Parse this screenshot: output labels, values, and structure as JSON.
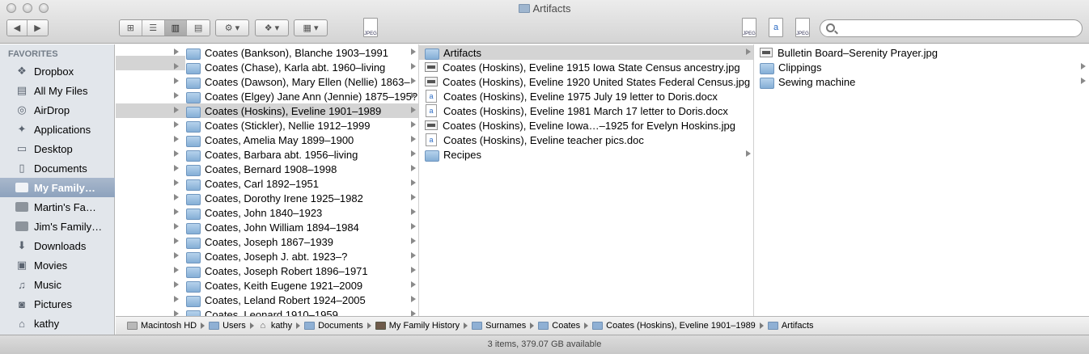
{
  "window": {
    "title": "Artifacts"
  },
  "toolbar": {
    "back_glyph": "◀",
    "forward_glyph": "▶",
    "view_modes": [
      {
        "icon": "icon-view-icon",
        "glyph": "⊞"
      },
      {
        "icon": "list-view-icon",
        "glyph": "☰"
      },
      {
        "icon": "column-view-icon",
        "glyph": "▥"
      },
      {
        "icon": "coverflow-view-icon",
        "glyph": "▤"
      }
    ],
    "action_glyph": "⚙ ▾",
    "dropbox_glyph": "❖ ▾",
    "arrange_glyph": "▦ ▾",
    "jpeg_label": "JPEG",
    "word_glyph": "a"
  },
  "sidebar": {
    "heading": "FAVORITES",
    "items": [
      {
        "label": "Dropbox",
        "icon": "dropbox-icon",
        "glyph": "❖"
      },
      {
        "label": "All My Files",
        "icon": "all-files-icon",
        "glyph": "▤"
      },
      {
        "label": "AirDrop",
        "icon": "airdrop-icon",
        "glyph": "◎"
      },
      {
        "label": "Applications",
        "icon": "applications-icon",
        "glyph": "✦"
      },
      {
        "label": "Desktop",
        "icon": "desktop-icon",
        "glyph": "▭"
      },
      {
        "label": "Documents",
        "icon": "documents-icon",
        "glyph": "▯"
      },
      {
        "label": "My Family…",
        "icon": "folder-icon",
        "glyph": ""
      },
      {
        "label": "Martin's Fa…",
        "icon": "folder-icon",
        "glyph": ""
      },
      {
        "label": "Jim's Family…",
        "icon": "folder-icon",
        "glyph": ""
      },
      {
        "label": "Downloads",
        "icon": "downloads-icon",
        "glyph": "⬇"
      },
      {
        "label": "Movies",
        "icon": "movies-icon",
        "glyph": "▣"
      },
      {
        "label": "Music",
        "icon": "music-icon",
        "glyph": "♫"
      },
      {
        "label": "Pictures",
        "icon": "pictures-icon",
        "glyph": "◙"
      },
      {
        "label": "kathy",
        "icon": "home-icon",
        "glyph": "⌂"
      }
    ],
    "selected_index": 6
  },
  "columns": {
    "surnames": [
      "Coates (Bankson), Blanche 1903–1991",
      "Coates (Chase), Karla abt. 1960–living",
      "Coates (Dawson), Mary Ellen (Nellie) 1863–",
      "Coates (Elgey) Jane Ann (Jennie) 1875–195?",
      "Coates (Hoskins), Eveline 1901–1989",
      "Coates (Stickler), Nellie 1912–1999",
      "Coates, Amelia May 1899–1900",
      "Coates, Barbara abt. 1956–living",
      "Coates, Bernard 1908–1998",
      "Coates, Carl 1892–1951",
      "Coates, Dorothy Irene 1925–1982",
      "Coates, John 1840–1923",
      "Coates, John William 1894–1984",
      "Coates, Joseph 1867–1939",
      "Coates, Joseph J. abt. 1923–?",
      "Coates, Joseph Robert 1896–1971",
      "Coates, Keith Eugene 1921–2009",
      "Coates, Leland Robert 1924–2005",
      "Coates, Leonard 1910–1959"
    ],
    "surnames_selected": 4,
    "eveline": [
      {
        "label": "Artifacts",
        "kind": "folder"
      },
      {
        "label": "Coates (Hoskins), Eveline 1915 Iowa State Census ancestry.jpg",
        "kind": "image"
      },
      {
        "label": "Coates (Hoskins), Eveline 1920 United States Federal Census.jpg",
        "kind": "image"
      },
      {
        "label": "Coates (Hoskins), Eveline 1975 July 19 letter to Doris.docx",
        "kind": "word"
      },
      {
        "label": "Coates (Hoskins), Eveline 1981 March 17 letter to Doris.docx",
        "kind": "word"
      },
      {
        "label": "Coates (Hoskins), Eveline Iowa…–1925 for Evelyn Hoskins.jpg",
        "kind": "image"
      },
      {
        "label": "Coates (Hoskins), Eveline teacher pics.doc",
        "kind": "word"
      },
      {
        "label": "Recipes",
        "kind": "folder"
      }
    ],
    "eveline_selected": 0,
    "artifacts": [
      {
        "label": "Bulletin Board–Serenity Prayer.jpg",
        "kind": "image"
      },
      {
        "label": "Clippings",
        "kind": "folder"
      },
      {
        "label": "Sewing machine",
        "kind": "folder"
      }
    ]
  },
  "pathbar": [
    {
      "label": "Macintosh HD",
      "icon": "hd"
    },
    {
      "label": "Users",
      "icon": "folder"
    },
    {
      "label": "kathy",
      "icon": "home"
    },
    {
      "label": "Documents",
      "icon": "folder"
    },
    {
      "label": "My Family History",
      "icon": "photo"
    },
    {
      "label": "Surnames",
      "icon": "folder"
    },
    {
      "label": "Coates",
      "icon": "folder"
    },
    {
      "label": "Coates (Hoskins), Eveline 1901–1989",
      "icon": "folder"
    },
    {
      "label": "Artifacts",
      "icon": "folder"
    }
  ],
  "status": {
    "text": "3 items, 379.07 GB available"
  }
}
